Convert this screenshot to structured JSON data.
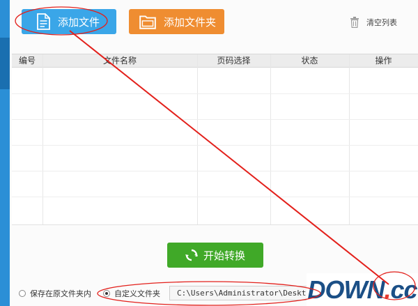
{
  "toolbar": {
    "add_file_label": "添加文件",
    "add_folder_label": "添加文件夹",
    "clear_list_label": "清空列表"
  },
  "table": {
    "columns": [
      "编号",
      "文件名称",
      "页码选择",
      "状态",
      "操作"
    ],
    "rows": []
  },
  "actions": {
    "start_label": "开始转换"
  },
  "output": {
    "option_original": "保存在原文件夹内",
    "option_custom": "自定义文件夹",
    "selected": "custom",
    "path_value": "C:\\Users\\Administrator\\Desktop"
  },
  "watermark": {
    "text_main": "DOWN",
    "text_dot": ".",
    "text_tail": "cc"
  },
  "colors": {
    "add_file_button": "#3aa6e8",
    "add_folder_button": "#ef8d31",
    "start_button": "#40a928",
    "annotation": "#e3201b"
  }
}
